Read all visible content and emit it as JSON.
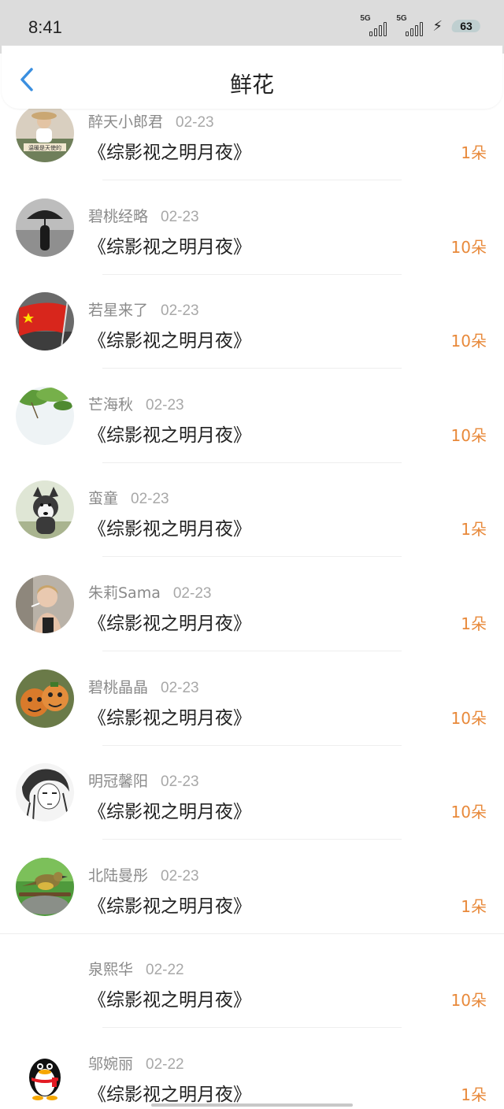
{
  "status_bar": {
    "time": "8:41",
    "network_1": "5G",
    "network_2": "5G",
    "battery": "63"
  },
  "header": {
    "title": "鲜花"
  },
  "colors": {
    "accent_back": "#3a8fe0",
    "quantity": "#e8893a"
  },
  "gifts": [
    {
      "user": "醉天小郎君",
      "date": "02-23",
      "book": "《综影视之明月夜》",
      "quantity": "1朵",
      "avatar": "girl-with-hat"
    },
    {
      "user": "碧桃经略",
      "date": "02-23",
      "book": "《综影视之明月夜》",
      "quantity": "10朵",
      "avatar": "umbrella-silhouette"
    },
    {
      "user": "若星来了",
      "date": "02-23",
      "book": "《综影视之明月夜》",
      "quantity": "10朵",
      "avatar": "red-flag"
    },
    {
      "user": "芒海秋",
      "date": "02-23",
      "book": "《综影视之明月夜》",
      "quantity": "10朵",
      "avatar": "green-leaves"
    },
    {
      "user": "蛮童",
      "date": "02-23",
      "book": "《综影视之明月夜》",
      "quantity": "1朵",
      "avatar": "husky-dog"
    },
    {
      "user": "朱莉Sama",
      "date": "02-23",
      "book": "《综影视之明月夜》",
      "quantity": "1朵",
      "avatar": "person-smoking"
    },
    {
      "user": "碧桃晶晶",
      "date": "02-23",
      "book": "《综影视之明月夜》",
      "quantity": "10朵",
      "avatar": "pumpkin-faces"
    },
    {
      "user": "明冠馨阳",
      "date": "02-23",
      "book": "《综影视之明月夜》",
      "quantity": "10朵",
      "avatar": "anime-sketch"
    },
    {
      "user": "北陆曼彤",
      "date": "02-23",
      "book": "《综影视之明月夜》",
      "quantity": "1朵",
      "avatar": "bird-on-branch"
    },
    {
      "user": "泉熙华",
      "date": "02-22",
      "book": "《综影视之明月夜》",
      "quantity": "10朵",
      "avatar": "none"
    },
    {
      "user": "邬婉丽",
      "date": "02-22",
      "book": "《综影视之明月夜》",
      "quantity": "1朵",
      "avatar": "penguin"
    }
  ]
}
